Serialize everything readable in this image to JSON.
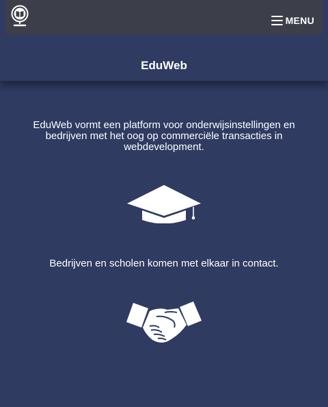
{
  "navbar": {
    "logo_icon": "book-globe-icon",
    "menu_icon": "hamburger-icon",
    "menu_label": "MENU"
  },
  "header": {
    "title": "EduWeb"
  },
  "main": {
    "intro_text": "EduWeb vormt een platform voor onderwijsinstellingen en bedrijven met het oog op commerciële transacties in webdevelopment.",
    "icon_1": "graduation-cap-icon",
    "contact_text": "Bedrijven en scholen komen met elkaar in contact.",
    "icon_2": "handshake-icon"
  },
  "colors": {
    "background": "#2f3b61",
    "navbar": "#3c3f4a",
    "text": "#ffffff"
  }
}
